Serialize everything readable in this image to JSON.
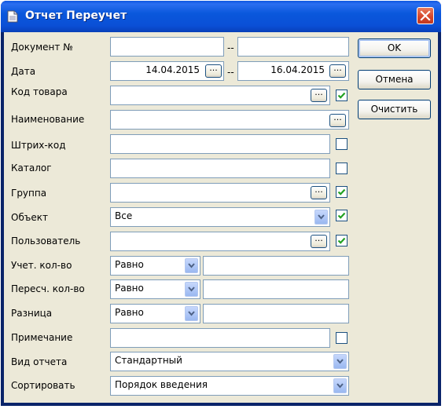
{
  "window": {
    "title": "Отчет Переучет"
  },
  "labels": {
    "document": "Документ №",
    "date": "Дата",
    "product_code": "Код товара",
    "name": "Наименование",
    "barcode": "Штрих-код",
    "catalog": "Каталог",
    "group": "Группа",
    "object": "Объект",
    "user": "Пользователь",
    "acc_qty": "Учет. кол-во",
    "recount_qty": "Пересч. кол-во",
    "difference": "Разница",
    "note": "Примечание",
    "report_type": "Вид отчета",
    "sort": "Сортировать"
  },
  "fields": {
    "doc_from": "",
    "doc_to": "",
    "date_from": "14.04.2015",
    "date_to": "16.04.2015",
    "object_value": "Все",
    "acc_qty_op": "Равно",
    "recount_qty_op": "Равно",
    "difference_op": "Равно",
    "report_type_value": "Стандартный",
    "sort_value": "Порядок введения",
    "range_dash": "--",
    "browse_label": "..."
  },
  "checkboxes": {
    "product_code": true,
    "barcode": false,
    "catalog": false,
    "group": true,
    "object": true,
    "user": true,
    "note": false
  },
  "buttons": {
    "ok": "OK",
    "cancel": "Отмена",
    "clear": "Очистить"
  },
  "colors": {
    "titlebar": "#0a58dc",
    "close": "#d5452a",
    "dialog_bg": "#ece9d8",
    "field_border": "#7f9db9"
  },
  "icons": {
    "title": "document-icon",
    "close": "close-icon",
    "dropdown": "chevron-down-icon",
    "check": "checkmark-icon"
  }
}
